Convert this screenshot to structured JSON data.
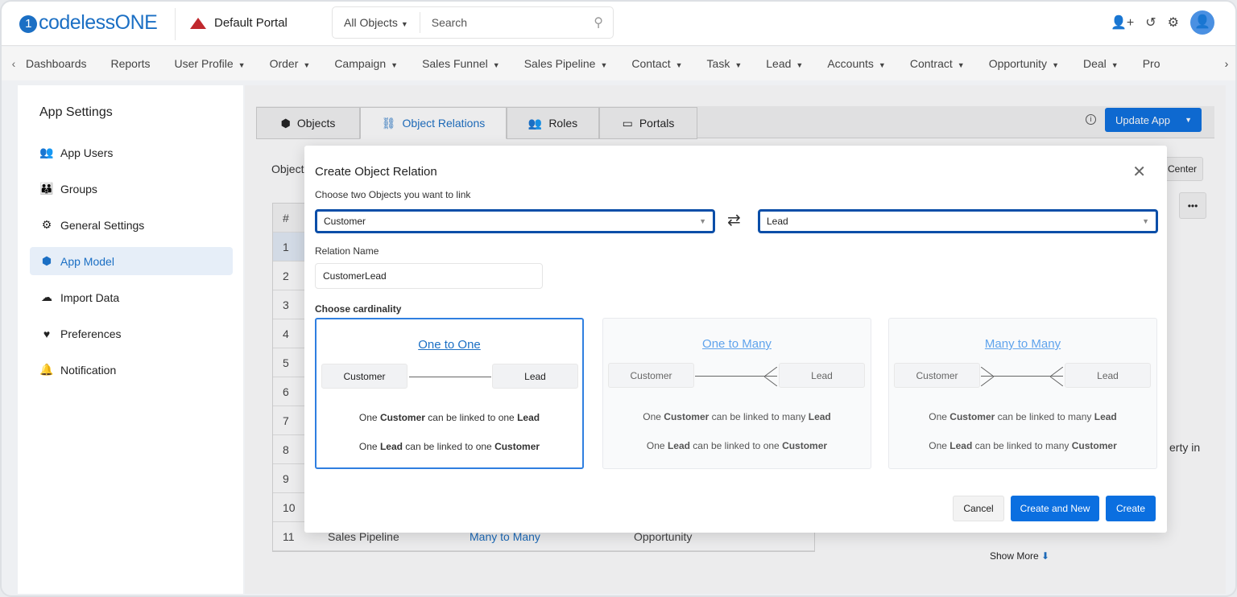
{
  "header": {
    "logo": "codelessONE",
    "portal": "Default Portal",
    "search_scope": "All Objects",
    "search_placeholder": "Search"
  },
  "nav": {
    "items": [
      {
        "label": "Dashboards",
        "dd": false
      },
      {
        "label": "Reports",
        "dd": false
      },
      {
        "label": "User Profile",
        "dd": true
      },
      {
        "label": "Order",
        "dd": true
      },
      {
        "label": "Campaign",
        "dd": true
      },
      {
        "label": "Sales Funnel",
        "dd": true
      },
      {
        "label": "Sales Pipeline",
        "dd": true
      },
      {
        "label": "Contact",
        "dd": true
      },
      {
        "label": "Task",
        "dd": true
      },
      {
        "label": "Lead",
        "dd": true
      },
      {
        "label": "Accounts",
        "dd": true
      },
      {
        "label": "Contract",
        "dd": true
      },
      {
        "label": "Opportunity",
        "dd": true
      },
      {
        "label": "Deal",
        "dd": true
      },
      {
        "label": "Pro",
        "dd": false
      }
    ]
  },
  "sidebar": {
    "title": "App Settings",
    "items": [
      {
        "label": "App Users",
        "icon": "users-icon"
      },
      {
        "label": "Groups",
        "icon": "group-icon"
      },
      {
        "label": "General Settings",
        "icon": "gear-icon"
      },
      {
        "label": "App Model",
        "icon": "cube-icon",
        "active": true
      },
      {
        "label": "Import Data",
        "icon": "cloud-upload-icon"
      },
      {
        "label": "Preferences",
        "icon": "hand-heart-icon"
      },
      {
        "label": "Notification",
        "icon": "bell-icon"
      }
    ]
  },
  "tabs": [
    "Objects",
    "Object Relations",
    "Roles",
    "Portals"
  ],
  "update_app": "Update App",
  "background": {
    "objects_label": "Object",
    "col_hash": "#",
    "rows": [
      "1",
      "2",
      "3",
      "4",
      "5",
      "6",
      "7",
      "8",
      "9",
      "10",
      "11"
    ],
    "last_row": {
      "c1": "Sales Pipeline",
      "c2": "Many to Many",
      "c3": "Opportunity"
    },
    "center_btn": "Center",
    "more_btn": "•••",
    "partial_text": "erty in",
    "show_more": "Show More"
  },
  "modal": {
    "title": "Create Object Relation",
    "choose_label": "Choose two Objects you want to link",
    "object1": "Customer",
    "object2": "Lead",
    "relation_name_label": "Relation Name",
    "relation_name": "CustomerLead",
    "cardinality_label": "Choose cardinality",
    "cards": [
      {
        "title": "One to One",
        "left": "Customer",
        "right": "Lead",
        "d1": [
          "One",
          "Customer",
          "can be linked to one",
          "Lead"
        ],
        "d2": [
          "One",
          "Lead",
          "can be linked to one",
          "Customer"
        ]
      },
      {
        "title": "One to Many",
        "left": "Customer",
        "right": "Lead",
        "d1": [
          "One",
          "Customer",
          "can be linked to many",
          "Lead"
        ],
        "d2": [
          "One",
          "Lead",
          "can be linked to one",
          "Customer"
        ]
      },
      {
        "title": "Many to Many",
        "left": "Customer",
        "right": "Lead",
        "d1": [
          "One",
          "Customer",
          "can be linked to many",
          "Lead"
        ],
        "d2": [
          "One",
          "Lead",
          "can be linked to many",
          "Customer"
        ]
      }
    ],
    "cancel": "Cancel",
    "create_new": "Create and New",
    "create": "Create"
  }
}
